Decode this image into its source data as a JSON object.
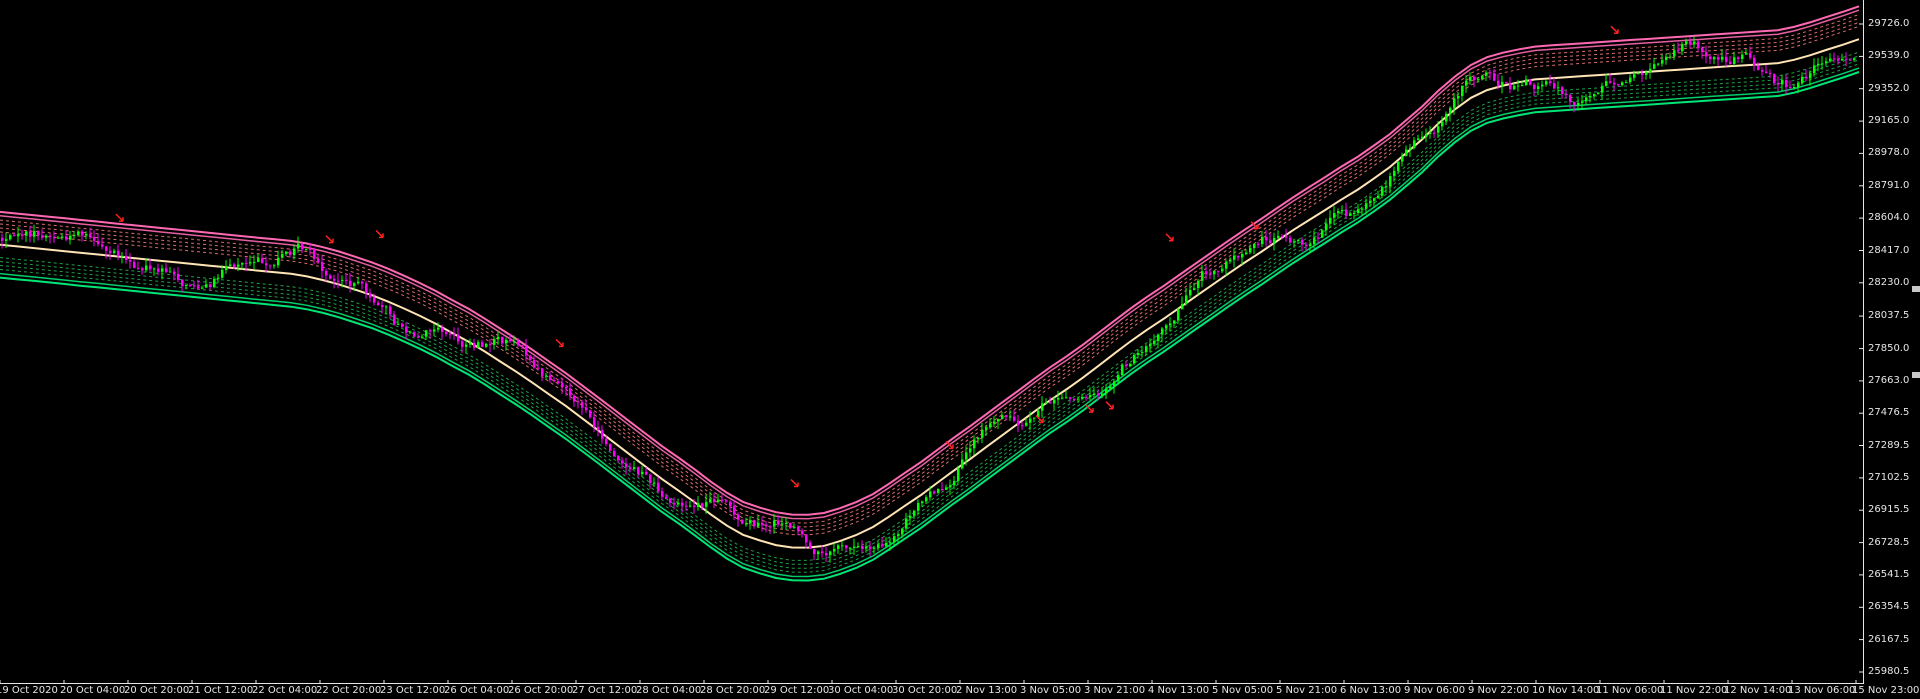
{
  "chart_data": {
    "type": "line",
    "title": "",
    "xlabel": "",
    "ylabel": "",
    "background": "#000000",
    "ylim": [
      25980.0,
      29820.0
    ],
    "y_ticks": [
      "29726.0",
      "29539.0",
      "29352.0",
      "29165.0",
      "28978.0",
      "28791.0",
      "28604.0",
      "28417.0",
      "28230.0",
      "28037.5",
      "27850.0",
      "27663.0",
      "27476.5",
      "27289.5",
      "27102.5",
      "26915.5",
      "26728.5",
      "26541.5",
      "26354.5",
      "26167.5",
      "25980.5"
    ],
    "x_ticks": [
      "19 Oct 2020",
      "20 Oct 04:00",
      "20 Oct 20:00",
      "21 Oct 12:00",
      "22 Oct 04:00",
      "22 Oct 20:00",
      "23 Oct 12:00",
      "26 Oct 04:00",
      "26 Oct 20:00",
      "27 Oct 12:00",
      "28 Oct 04:00",
      "28 Oct 20:00",
      "29 Oct 12:00",
      "30 Oct 04:00",
      "30 Oct 20:00",
      "2 Nov 13:00",
      "3 Nov 05:00",
      "3 Nov 21:00",
      "4 Nov 13:00",
      "5 Nov 05:00",
      "5 Nov 21:00",
      "6 Nov 13:00",
      "9 Nov 06:00",
      "9 Nov 22:00",
      "10 Nov 14:00",
      "11 Nov 06:00",
      "11 Nov 22:00",
      "12 Nov 14:00",
      "13 Nov 06:00",
      "15 Nov 23:00"
    ],
    "colors": {
      "candle_up": "#00ff00",
      "candle_down": "#ff00ff",
      "mid_line": "#ffe4b5",
      "upper_band": "#ff69b4",
      "lower_band": "#00e676",
      "upper_inner": "#ff8080",
      "lower_inner": "#22b14c",
      "signal_arrow": "#ff2020",
      "axis_text": "#e6e6e6"
    },
    "series": [
      {
        "x": [
          0,
          16,
          33,
          49,
          65,
          80,
          97,
          113,
          129,
          145,
          161,
          178,
          194,
          210,
          226,
          242,
          258,
          275,
          291,
          307,
          323,
          339,
          355,
          372,
          388,
          404,
          420,
          436,
          452,
          469,
          485,
          501,
          517,
          533,
          549,
          566,
          582,
          598,
          614,
          630,
          646,
          662,
          679,
          695,
          711,
          727,
          743,
          760,
          776,
          792,
          808,
          824,
          840,
          856,
          873,
          889,
          905,
          921,
          937,
          953,
          970,
          986,
          1002,
          1018,
          1034,
          1050,
          1067,
          1083,
          1099,
          1115,
          1131,
          1147,
          1164,
          1180,
          1196,
          1212,
          1228,
          1244,
          1261,
          1277,
          1293,
          1309,
          1325,
          1341,
          1358,
          1374,
          1390,
          1406,
          1422,
          1438,
          1455,
          1471,
          1487,
          1503,
          1519,
          1535,
          1552,
          1568,
          1584,
          1600,
          1616,
          1632,
          1649,
          1665,
          1681,
          1697,
          1713,
          1729,
          1746,
          1762,
          1778,
          1794,
          1810,
          1826,
          1843,
          1859
        ],
        "values": [
          28450.2,
          28440.9,
          28431.5,
          28422.2,
          28412.9,
          28403.5,
          28394.2,
          28384.8,
          28375.5,
          28366.2,
          28356.8,
          28347.5,
          28338.2,
          28328.8,
          28319.5,
          28310.1,
          28300.8,
          28291.5,
          28282.1,
          28267.1,
          28246.0,
          28220.9,
          28190.9,
          28158.2,
          28121.6,
          28081.3,
          28038.6,
          27992.3,
          27940.6,
          27888.4,
          27832.3,
          27772.3,
          27713.2,
          27650.6,
          27585.6,
          27517.3,
          27447.7,
          27378.3,
          27307.5,
          27236.5,
          27166.0,
          27095.6,
          27027.5,
          26960.2,
          26890.0,
          26826.2,
          26773.7,
          26740.4,
          26713.9,
          26700.3,
          26699.5,
          26709.5,
          26737.4,
          26771.9,
          26818.8,
          26878.4,
          26941.7,
          27003.5,
          27072.8,
          27141.4,
          27210.4,
          27279.7,
          27347.8,
          27415.5,
          27484.3,
          27551.2,
          27616.5,
          27682.1,
          27752.6,
          27823.5,
          27893.5,
          27958.5,
          28023.2,
          28087.8,
          28152.8,
          28216.9,
          28281.4,
          28344.4,
          28408.1,
          28471.4,
          28534.0,
          28592.4,
          28650.4,
          28710.1,
          28769.6,
          28833.5,
          28900.2,
          28978.7,
          29058.3,
          29148.7,
          29232.7,
          29299.3,
          29344.1,
          29369.9,
          29389.7,
          29405.6,
          29412.7,
          29419.0,
          29425.2,
          29431.4,
          29437.7,
          29443.9,
          29450.1,
          29456.4,
          29462.6,
          29468.8,
          29475.1,
          29481.3,
          29487.5,
          29493.8,
          29500.0,
          29519.1,
          29545.3,
          29575.5,
          29606.6,
          29638.4
        ],
        "band_offset": 190
      }
    ]
  },
  "price_axis": {
    "labels": [
      "29726.0",
      "29539.0",
      "29352.0",
      "29165.0",
      "28978.0",
      "28791.0",
      "28604.0",
      "28417.0",
      "28230.0",
      "28037.5",
      "27850.0",
      "27663.0",
      "27476.5",
      "27289.5",
      "27102.5",
      "26915.5",
      "26728.5",
      "26541.5",
      "26354.5",
      "26167.5",
      "25980.5"
    ]
  },
  "time_axis": {
    "labels": [
      "19 Oct 2020",
      "20 Oct 04:00",
      "20 Oct 20:00",
      "21 Oct 12:00",
      "22 Oct 04:00",
      "22 Oct 20:00",
      "23 Oct 12:00",
      "26 Oct 04:00",
      "26 Oct 20:00",
      "27 Oct 12:00",
      "28 Oct 04:00",
      "28 Oct 20:00",
      "29 Oct 12:00",
      "30 Oct 04:00",
      "30 Oct 20:00",
      "2 Nov 13:00",
      "3 Nov 05:00",
      "3 Nov 21:00",
      "4 Nov 13:00",
      "5 Nov 05:00",
      "5 Nov 21:00",
      "6 Nov 13:00",
      "9 Nov 06:00",
      "9 Nov 22:00",
      "10 Nov 14:00",
      "11 Nov 06:00",
      "11 Nov 22:00",
      "12 Nov 14:00",
      "13 Nov 06:00",
      "15 Nov 23:00"
    ]
  }
}
